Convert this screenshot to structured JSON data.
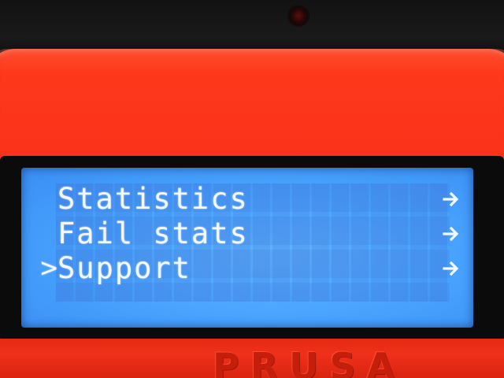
{
  "device": {
    "brand_emboss": "PRUSA"
  },
  "lcd_menu": {
    "items": [
      {
        "label": "Statistics",
        "selected": false,
        "submenu_arrow": "→"
      },
      {
        "label": "Fail stats",
        "selected": false,
        "submenu_arrow": "→"
      },
      {
        "label": "Support",
        "selected": true,
        "submenu_arrow": "→"
      }
    ],
    "cursor_char": ">"
  },
  "colors": {
    "housing": "#f0301a",
    "lcd_background": "#4aa6ff",
    "lcd_text": "#f4f9ff"
  },
  "icons": {
    "selection_cursor": "chevron-right-icon",
    "submenu": "arrow-right-icon"
  }
}
